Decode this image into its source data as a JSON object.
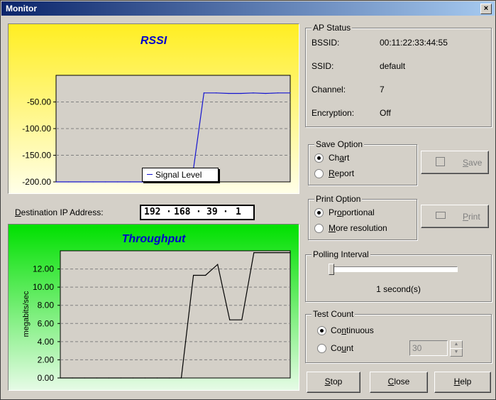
{
  "window": {
    "title": "Monitor",
    "close_glyph": "×"
  },
  "rssi": {
    "title": "RSSI",
    "legend": "Signal Level",
    "chart_data": {
      "type": "line",
      "title": "RSSI",
      "ylim": [
        -200,
        0
      ],
      "yticks": [
        "-50.00",
        "-100.00",
        "-150.00",
        "-200.00"
      ],
      "series": [
        {
          "name": "Signal Level",
          "x": [
            0,
            1,
            2,
            3,
            4,
            5,
            6,
            7,
            8,
            9,
            10,
            11,
            12,
            13,
            14,
            15,
            16,
            17,
            18,
            19
          ],
          "values": [
            -200,
            -200,
            -200,
            -200,
            -200,
            -200,
            -200,
            -200,
            -200,
            -200,
            -200,
            -200,
            -33,
            -33,
            -34,
            -34,
            -33,
            -34,
            -33,
            -33
          ]
        }
      ],
      "colors": {
        "series": "#1414d0",
        "top": "#ffee22",
        "bottom": "#ffffe8"
      }
    }
  },
  "destination": {
    "label": "Destination IP Address:",
    "ip": [
      "192",
      "168",
      "39",
      "1"
    ]
  },
  "throughput": {
    "title": "Throughput",
    "chart_data": {
      "type": "line",
      "title": "Throughput",
      "ylabel": "megabits/sec",
      "ylim": [
        0,
        14
      ],
      "yticks": [
        "12.00",
        "10.00",
        "8.00",
        "6.00",
        "4.00",
        "2.00",
        "0.00"
      ],
      "series": [
        {
          "x": [
            0,
            1,
            2,
            3,
            4,
            5,
            6,
            7,
            8,
            9,
            10,
            11,
            12,
            13,
            14,
            15,
            16,
            17,
            18,
            19
          ],
          "values": [
            0,
            0,
            0,
            0,
            0,
            0,
            0,
            0,
            0,
            0,
            0,
            11.3,
            11.3,
            12.5,
            6.4,
            6.4,
            13.8,
            13.8,
            13.8,
            13.8
          ]
        }
      ],
      "colors": {
        "series": "#000000",
        "top": "#00e000",
        "bottom": "#e6fbe6"
      }
    }
  },
  "ap_status": {
    "title": "AP Status",
    "rows": [
      {
        "label": "BSSID:",
        "value": "00:11:22:33:44:55"
      },
      {
        "label": "SSID:",
        "value": "default"
      },
      {
        "label": "Channel:",
        "value": "7"
      },
      {
        "label": "Encryption:",
        "value": "Off"
      }
    ]
  },
  "save_option": {
    "title": "Save Option",
    "opt1": "Chart",
    "opt2": "Report",
    "selected": 1,
    "button": "Save"
  },
  "print_option": {
    "title": "Print Option",
    "opt1": "Proportional",
    "opt2": "More resolution",
    "selected": 1,
    "button": "Print"
  },
  "polling": {
    "title": "Polling Interval",
    "value_text": "1 second(s)",
    "slider_fraction": 0
  },
  "test_count": {
    "title": "Test Count",
    "opt1": "Continuous",
    "opt2": "Count",
    "selected": 1,
    "count_value": "30"
  },
  "buttons": {
    "stop": "Stop",
    "close": "Close",
    "help": "Help"
  }
}
